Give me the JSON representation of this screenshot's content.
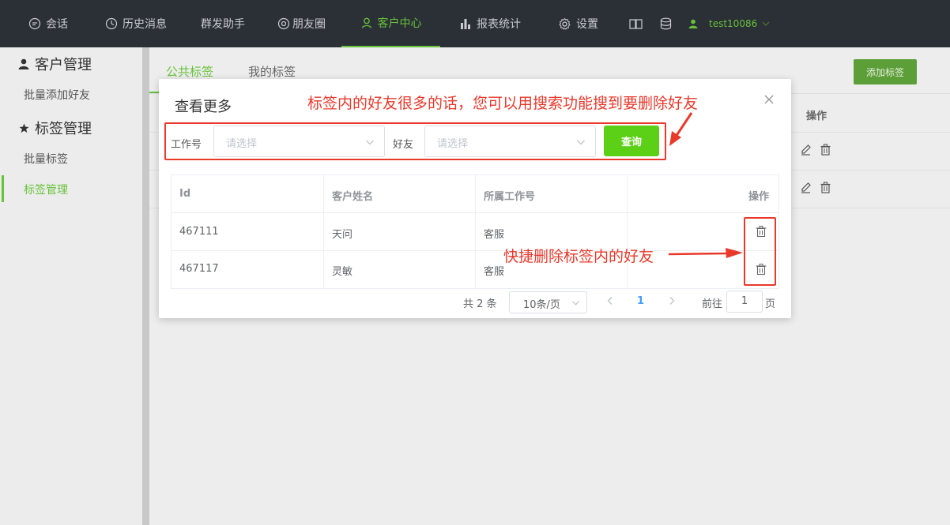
{
  "topnav": {
    "items": [
      {
        "label": "会话",
        "icon": "chat-icon"
      },
      {
        "label": "历史消息",
        "icon": "clock-icon"
      },
      {
        "label": "群发助手",
        "icon": ""
      },
      {
        "label": "朋友圈",
        "icon": "aperture-icon"
      },
      {
        "label": "客户中心",
        "icon": "user-icon",
        "active": true
      },
      {
        "label": "报表统计",
        "icon": "bar-chart-icon"
      },
      {
        "label": "设置",
        "icon": "gear-icon"
      }
    ],
    "username": "test10086",
    "active_color": "#67c23a"
  },
  "sidebar": {
    "groups": [
      {
        "title": "客户管理",
        "icon": "person-icon",
        "items": [
          "批量添加好友"
        ]
      },
      {
        "title": "标签管理",
        "icon": "star-icon",
        "items": [
          "批量标签",
          "标签管理"
        ]
      }
    ],
    "active_item": "标签管理"
  },
  "main": {
    "tabs": [
      "公共标签",
      "我的标签"
    ],
    "active_tab": "公共标签",
    "add_button": "添加标签",
    "op_header": "操作"
  },
  "dialog": {
    "title": "查看更多",
    "form": {
      "job_label": "工作号",
      "job_placeholder": "请选择",
      "friend_label": "好友",
      "friend_placeholder": "请选择",
      "query_button": "查询"
    },
    "table": {
      "headers": [
        "Id",
        "客户姓名",
        "所属工作号",
        "操作"
      ],
      "rows": [
        {
          "id": "467111",
          "name": "天问",
          "job": "客服"
        },
        {
          "id": "467117",
          "name": "灵敏",
          "job": "客服"
        }
      ]
    },
    "pagination": {
      "total": "共 2 条",
      "page_size": "10条/页",
      "current_page": "1",
      "goto_label": "前往",
      "goto_value": "1",
      "page_suffix": "页"
    }
  },
  "annotations": {
    "search_tip": "标签内的好友很多的话，您可以用搜索功能搜到要删除好友",
    "delete_tip": "快捷删除标签内的好友",
    "color": "#e8392b"
  }
}
